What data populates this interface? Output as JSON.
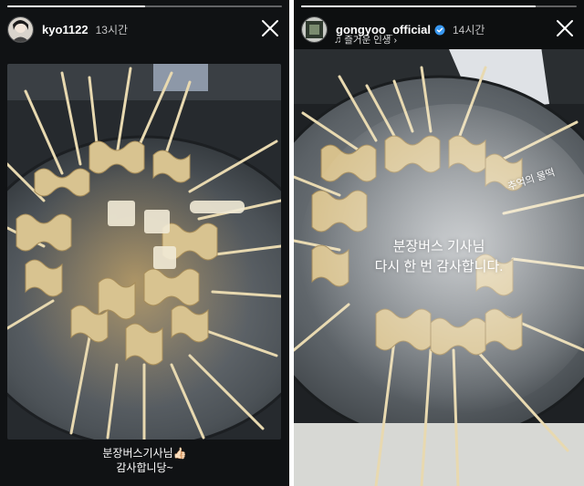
{
  "left_story": {
    "username": "kyo1122",
    "time": "13시간",
    "caption_line1": "분장버스기사님👍🏻",
    "caption_line2": "감사합니당~",
    "progress": 0.5
  },
  "right_story": {
    "username": "gongyoo_official",
    "time": "14시간",
    "music": "즐거운 인생",
    "overlay_line1": "분장버스 기사님",
    "overlay_line2": "다시 한 번 감사합니다.",
    "overlay_sub": "추억의 물떡",
    "progress": 0.85
  },
  "icons": {
    "verified": "verified-badge-icon",
    "close": "close-icon",
    "music": "music-note-icon",
    "chevron": "chevron-right-icon"
  },
  "colors": {
    "verified": "#3797f0",
    "panel_bg": "#101214"
  }
}
